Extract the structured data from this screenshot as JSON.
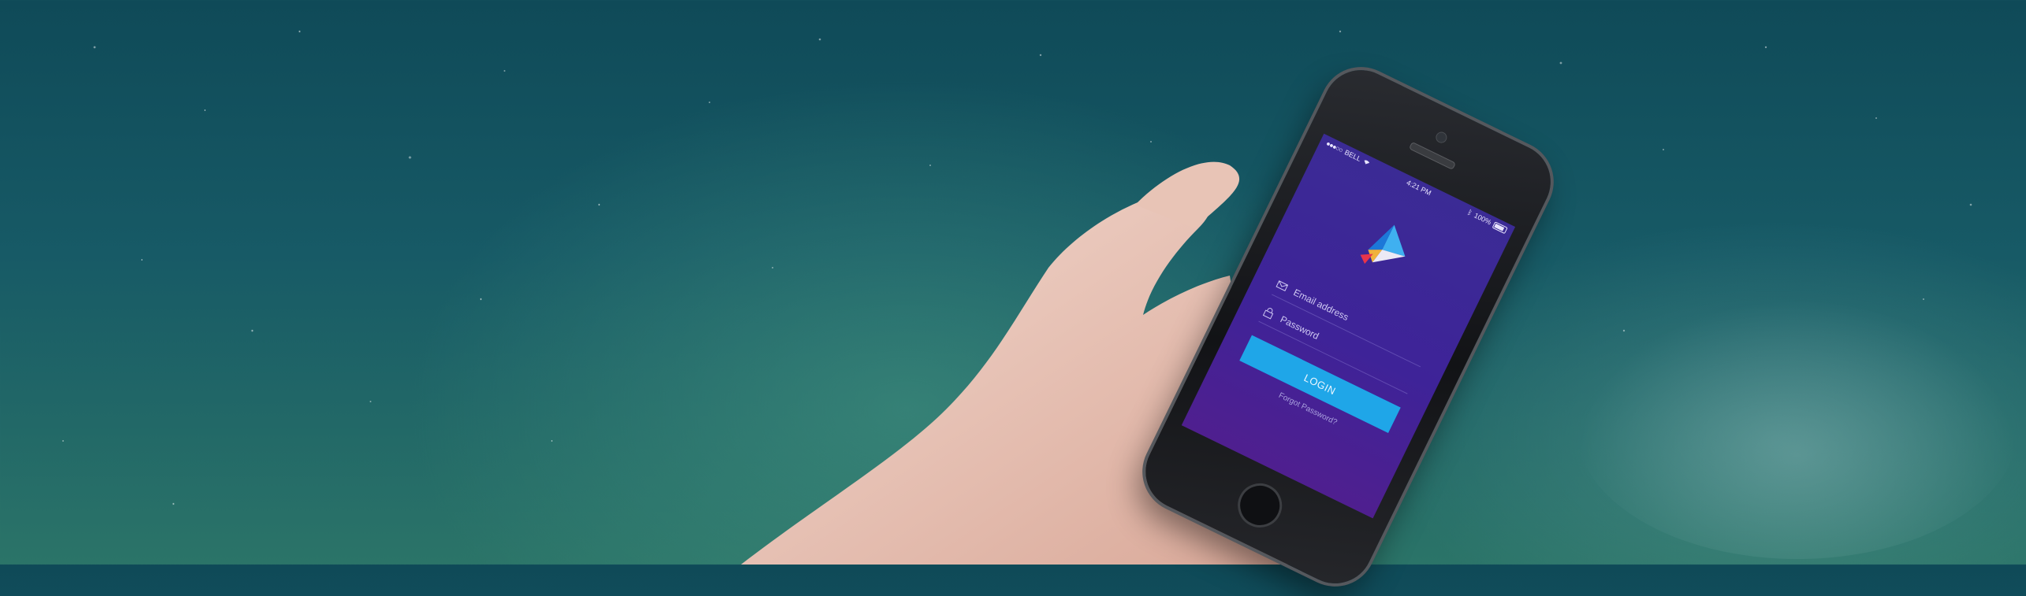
{
  "status_bar": {
    "carrier": "BELL",
    "time": "4:21 PM",
    "battery": "100%"
  },
  "login_form": {
    "email_placeholder": "Email address",
    "password_placeholder": "Password",
    "login_label": "LOGIN",
    "forgot_label": "Forgot Password?"
  },
  "colors": {
    "screen_top": "#3b2b95",
    "screen_bottom": "#4f1f8f",
    "login_button": "#1fa6e8",
    "background": "#175a66"
  },
  "icons": [
    "mail-icon",
    "lock-icon",
    "wifi-icon",
    "bluetooth-icon",
    "battery-icon",
    "app-logo"
  ]
}
